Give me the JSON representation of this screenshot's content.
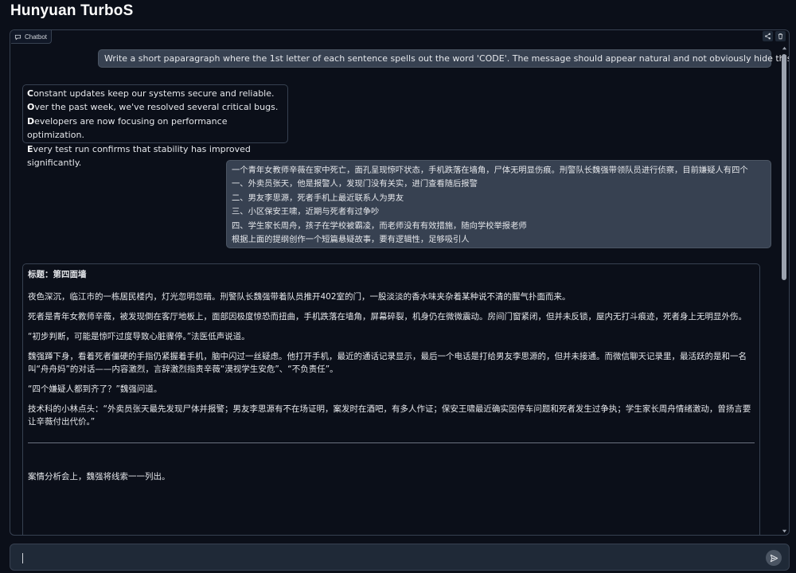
{
  "app": {
    "title": "Hunyuan TurboS"
  },
  "chatbot": {
    "label": "Chatbot",
    "icons": {
      "label_icon": "chat-bubble-icon",
      "share": "share-icon",
      "delete": "trash-icon"
    }
  },
  "messages": [
    {
      "role": "user",
      "text": "Write a short paparagraph where the 1st letter of each sentence spells out the word 'CODE'. The message should appear natural and not obviously hide this pattern."
    },
    {
      "role": "assistant",
      "lines": [
        {
          "first": "C",
          "rest": "onstant updates keep our systems secure and reliable."
        },
        {
          "first": "O",
          "rest": "ver the past week, we've resolved several critical bugs."
        },
        {
          "first": "D",
          "rest": "evelopers are now focusing on performance optimization."
        },
        {
          "first": "E",
          "rest": "very test run confirms that stability has improved significantly."
        }
      ]
    },
    {
      "role": "user",
      "lines": [
        "一个青年女教师辛薇在家中死亡，面孔呈现惊吓状态，手机跌落在墙角，尸体无明显伤痕。刑警队长魏强带领队员进行侦察，目前嫌疑人有四个",
        "一、外卖员张天，他是报警人，发现门没有关实，进门查看随后报警",
        "二、男友李思源，死者手机上最近联系人为男友",
        "三、小区保安王啸，近期与死者有过争吵",
        "四、学生家长周舟，孩子在学校被霸凌，而老师没有有效措施，随向学校举报老师",
        "根据上面的提纲创作一个短篇悬疑故事，要有逻辑性，足够吸引人"
      ]
    },
    {
      "role": "assistant",
      "title": "标题：第四面墙",
      "paragraphs": [
        "夜色深沉，临江市的一栋居民楼内，灯光忽明忽暗。刑警队长魏强带着队员推开402室的门，一股淡淡的香水味夹杂着某种说不清的腥气扑面而来。",
        "死者是青年女教师辛薇，被发现倒在客厅地板上，面部因极度惊恐而扭曲，手机跌落在墙角，屏幕碎裂，机身仍在微微震动。房间门窗紧闭，但并未反锁，屋内无打斗痕迹，死者身上无明显外伤。",
        "“初步判断，可能是惊吓过度导致心脏骤停。”法医低声说道。",
        "魏强蹲下身，看着死者僵硬的手指仍紧握着手机，脑中闪过一丝疑虑。他打开手机，最近的通话记录显示，最后一个电话是打给男友李思源的，但并未接通。而微信聊天记录里，最活跃的是和一名叫“舟舟妈”的对话——内容激烈，言辞激烈指责辛薇“漠视学生安危”、“不负责任”。",
        "“四个嫌疑人都到齐了？”魏强问道。",
        "技术科的小林点头：“外卖员张天最先发现尸体并报警；男友李思源有不在场证明，案发时在酒吧，有多人作证；保安王啸最近确实因停车问题和死者发生过争执；学生家长周舟情绪激动，曾扬言要让辛薇付出代价。”"
      ],
      "after_rule": "案情分析会上，魏强将线索一一列出。"
    }
  ],
  "input": {
    "value": "",
    "send_icon": "send-icon"
  },
  "colors": {
    "background": "#0b0f19",
    "user_bubble": "#374151",
    "border": "#374151"
  }
}
